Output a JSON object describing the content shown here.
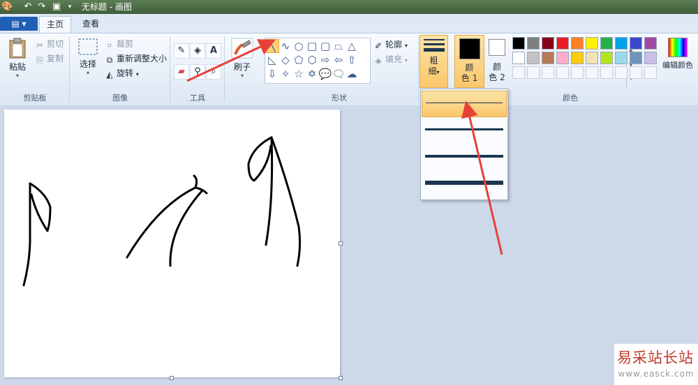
{
  "window": {
    "title": "无标题 - 画图"
  },
  "tabs": {
    "file_label": "▤ ▾",
    "home": "主页",
    "view": "查看"
  },
  "clipboard": {
    "paste": "粘贴",
    "cut": "剪切",
    "copy": "复制",
    "label": "剪贴板"
  },
  "image": {
    "select": "选择",
    "crop": "裁剪",
    "resize": "重新调整大小",
    "rotate": "旋转",
    "label": "图像"
  },
  "tools": {
    "label": "工具",
    "text_glyph": "A"
  },
  "brush": {
    "label": "刷子"
  },
  "shapes": {
    "outline": "轮廓",
    "fill": "填充",
    "label": "形状"
  },
  "size": {
    "label_line1": "粗",
    "label_line2": "细"
  },
  "colors": {
    "color1_line1": "颜",
    "color1_line2": "色 1",
    "color2_line1": "颜",
    "color2_line2": "色 2",
    "edit": "编辑颜色",
    "label": "颜色",
    "color1_value": "#000000",
    "color2_value": "#ffffff",
    "palette_row1": [
      "#000000",
      "#7f7f7f",
      "#880015",
      "#ed1c24",
      "#ff7f27",
      "#fff200",
      "#22b14c",
      "#00a2e8",
      "#3f48cc",
      "#a349a4"
    ],
    "palette_row2": [
      "#ffffff",
      "#c3c3c3",
      "#b97a57",
      "#ffaec9",
      "#ffc90e",
      "#efe4b0",
      "#b5e61d",
      "#99d9ea",
      "#7092be",
      "#c8bfe7"
    ]
  },
  "watermark": {
    "text": "易采站长站",
    "url": "www.easck.com"
  }
}
